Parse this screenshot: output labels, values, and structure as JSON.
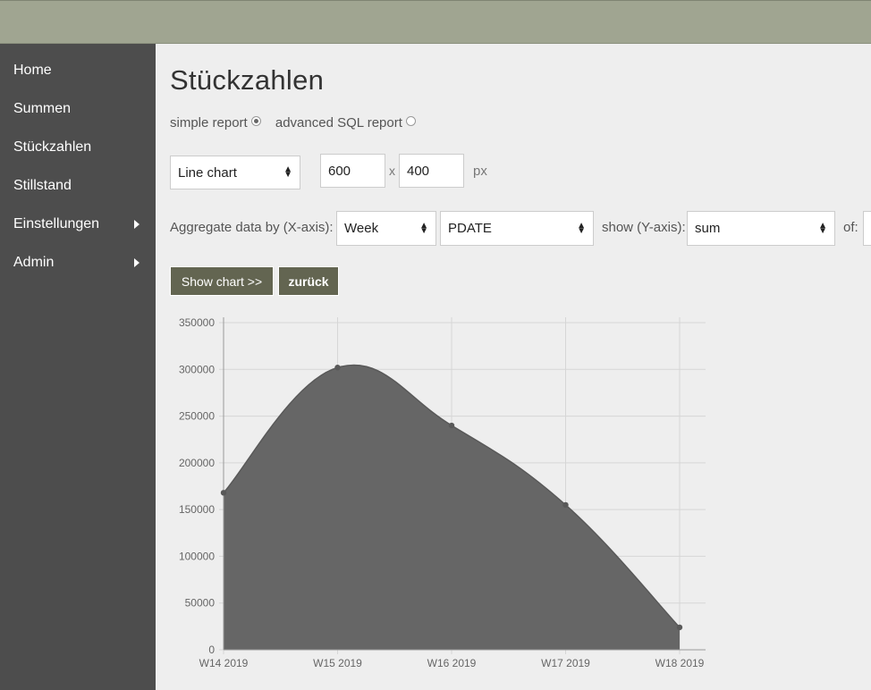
{
  "sidebar": {
    "items": [
      {
        "label": "Home"
      },
      {
        "label": "Summen"
      },
      {
        "label": "Stückzahlen"
      },
      {
        "label": "Stillstand"
      },
      {
        "label": "Einstellungen",
        "submenu": true
      },
      {
        "label": "Admin",
        "submenu": true
      }
    ]
  },
  "page": {
    "title": "Stückzahlen"
  },
  "report": {
    "simple_label": "simple report",
    "advanced_label": "advanced SQL report",
    "selected": "simple"
  },
  "chart_type": {
    "value": "Line chart"
  },
  "size": {
    "width": "600",
    "x": "x",
    "height": "400",
    "unit": "px"
  },
  "aggregate": {
    "label": "Aggregate data by (X-axis):",
    "period": "Week",
    "field": "PDATE",
    "show_label": "show (Y-axis):",
    "show_value": "sum",
    "of_label": "of:",
    "of_value": ""
  },
  "buttons": {
    "show_chart": "Show chart >>",
    "back": "zurück"
  },
  "colors": {
    "header": "#a0a591",
    "sidebar": "#4d4d4d",
    "button": "#636551",
    "area_fill": "#666666"
  },
  "chart_data": {
    "type": "area",
    "categories": [
      "W14 2019",
      "W15 2019",
      "W16 2019",
      "W17 2019",
      "W18 2019"
    ],
    "values": [
      168000,
      302000,
      240000,
      155000,
      24000
    ],
    "ylim": [
      0,
      350000
    ],
    "yticks": [
      0,
      50000,
      100000,
      150000,
      200000,
      250000,
      300000,
      350000
    ],
    "grid": true,
    "smooth": true
  }
}
